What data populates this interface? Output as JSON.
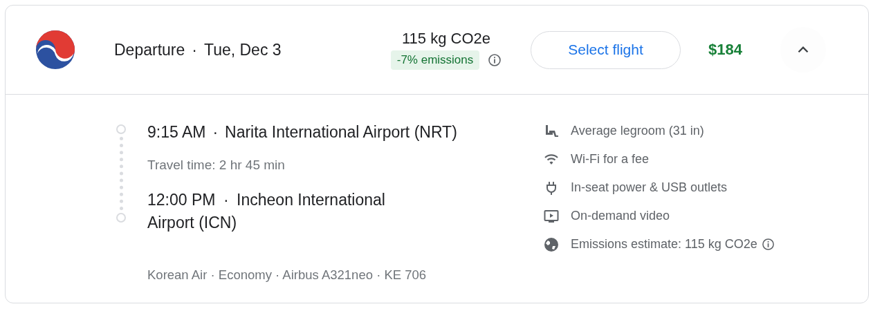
{
  "header": {
    "title": "Departure",
    "date": "Tue, Dec 3",
    "emissions": "115 kg CO2e",
    "emissions_badge": "-7% emissions",
    "button": "Select flight",
    "price": "$184",
    "expanded": true
  },
  "itinerary": {
    "departure": {
      "time": "9:15 AM",
      "airport": "Narita International Airport (NRT)"
    },
    "travel_time": "Travel time: 2 hr 45 min",
    "arrival": {
      "time": "12:00 PM",
      "airport": "Incheon International Airport (ICN)"
    },
    "separator": "·",
    "details": "Korean Air · Economy · Airbus A321neo · KE 706"
  },
  "amenities": [
    {
      "kind": "legroom",
      "label": "Average legroom (31 in)",
      "info": false
    },
    {
      "kind": "wifi",
      "label": "Wi-Fi for a fee",
      "info": false
    },
    {
      "kind": "power",
      "label": "In-seat power & USB outlets",
      "info": false
    },
    {
      "kind": "video",
      "label": "On-demand video",
      "info": false
    },
    {
      "kind": "emissions",
      "label": "Emissions estimate: 115 kg CO2e",
      "info": true
    }
  ]
}
